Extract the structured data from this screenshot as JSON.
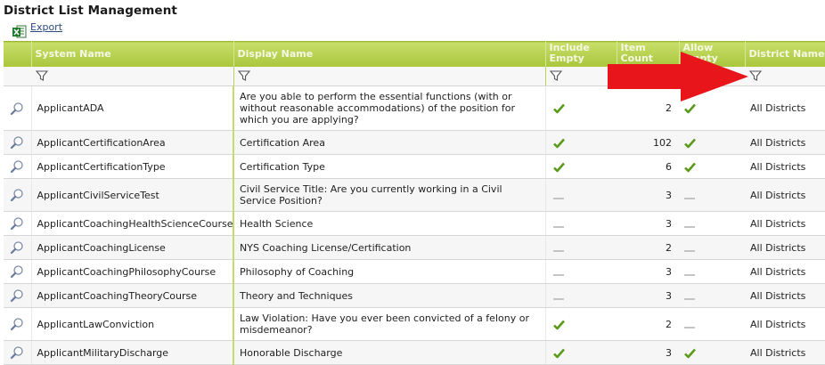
{
  "page": {
    "title": "District List Management",
    "export_label": "Export"
  },
  "columns": {
    "system_name": "System Name",
    "display_name": "Display Name",
    "include_empty_1": "Include",
    "include_empty_2": "Empty",
    "item_count_1": "Item",
    "item_count_2": "Count",
    "allow_empty_1": "Allow",
    "allow_empty_2": "Empty",
    "district_name": "District Name"
  },
  "colors": {
    "header_green": "#a9c63c",
    "check_green": "#5a9a18",
    "arrow_red": "#e8161b"
  },
  "rows": [
    {
      "system_name": "ApplicantADA",
      "display_name": "Are you able to perform the essential functions (with or without reasonable accommodations) of the position for which you are applying?",
      "include_empty": true,
      "item_count": "2",
      "allow_empty": true,
      "district": "All Districts"
    },
    {
      "system_name": "ApplicantCertificationArea",
      "display_name": "Certification Area",
      "include_empty": true,
      "item_count": "102",
      "allow_empty": true,
      "district": "All Districts"
    },
    {
      "system_name": "ApplicantCertificationType",
      "display_name": "Certification Type",
      "include_empty": true,
      "item_count": "6",
      "allow_empty": true,
      "district": "All Districts"
    },
    {
      "system_name": "ApplicantCivilServiceTest",
      "display_name": "Civil Service Title: Are you currently working in a Civil Service Position?",
      "include_empty": false,
      "item_count": "3",
      "allow_empty": false,
      "district": "All Districts"
    },
    {
      "system_name": "ApplicantCoachingHealthScienceCourse",
      "display_name": "Health Science",
      "include_empty": false,
      "item_count": "3",
      "allow_empty": false,
      "district": "All Districts"
    },
    {
      "system_name": "ApplicantCoachingLicense",
      "display_name": "NYS Coaching License/Certification",
      "include_empty": false,
      "item_count": "2",
      "allow_empty": false,
      "district": "All Districts"
    },
    {
      "system_name": "ApplicantCoachingPhilosophyCourse",
      "display_name": "Philosophy of Coaching",
      "include_empty": false,
      "item_count": "3",
      "allow_empty": false,
      "district": "All Districts"
    },
    {
      "system_name": "ApplicantCoachingTheoryCourse",
      "display_name": "Theory and Techniques",
      "include_empty": false,
      "item_count": "3",
      "allow_empty": false,
      "district": "All Districts"
    },
    {
      "system_name": "ApplicantLawConviction",
      "display_name": "Law Violation: Have you ever been convicted of a felony or misdemeanor?",
      "include_empty": true,
      "item_count": "2",
      "allow_empty": false,
      "district": "All Districts"
    },
    {
      "system_name": "ApplicantMilitaryDischarge",
      "display_name": "Honorable Discharge",
      "include_empty": true,
      "item_count": "3",
      "allow_empty": true,
      "district": "All Districts"
    }
  ]
}
